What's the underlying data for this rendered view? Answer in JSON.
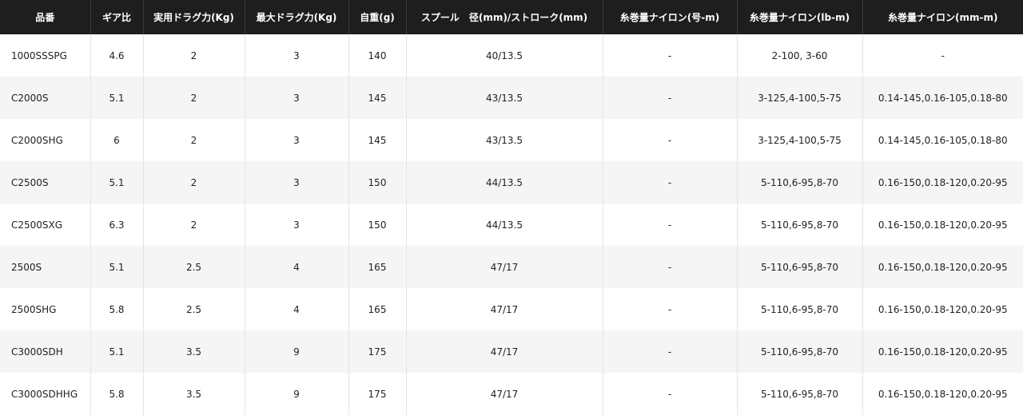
{
  "table": {
    "headers": [
      "品番",
      "ギア比",
      "実用ドラグ力(Kg)",
      "最大ドラグ力(Kg)",
      "自重(g)",
      "スプール　径(mm)/ストローク(mm)",
      "糸巻量ナイロン(号-m)",
      "糸巻量ナイロン(lb-m)",
      "糸巻量ナイロン(mm-m)"
    ],
    "rows": [
      [
        "1000SSSPG",
        "4.6",
        "2",
        "3",
        "140",
        "40/13.5",
        "-",
        "2-100, 3-60",
        "-"
      ],
      [
        "C2000S",
        "5.1",
        "2",
        "3",
        "145",
        "43/13.5",
        "-",
        "3-125,4-100,5-75",
        "0.14-145,0.16-105,0.18-80"
      ],
      [
        "C2000SHG",
        "6",
        "2",
        "3",
        "145",
        "43/13.5",
        "-",
        "3-125,4-100,5-75",
        "0.14-145,0.16-105,0.18-80"
      ],
      [
        "C2500S",
        "5.1",
        "2",
        "3",
        "150",
        "44/13.5",
        "-",
        "5-110,6-95,8-70",
        "0.16-150,0.18-120,0.20-95"
      ],
      [
        "C2500SXG",
        "6.3",
        "2",
        "3",
        "150",
        "44/13.5",
        "-",
        "5-110,6-95,8-70",
        "0.16-150,0.18-120,0.20-95"
      ],
      [
        "2500S",
        "5.1",
        "2.5",
        "4",
        "165",
        "47/17",
        "-",
        "5-110,6-95,8-70",
        "0.16-150,0.18-120,0.20-95"
      ],
      [
        "2500SHG",
        "5.8",
        "2.5",
        "4",
        "165",
        "47/17",
        "-",
        "5-110,6-95,8-70",
        "0.16-150,0.18-120,0.20-95"
      ],
      [
        "C3000SDH",
        "5.1",
        "3.5",
        "9",
        "175",
        "47/17",
        "-",
        "5-110,6-95,8-70",
        "0.16-150,0.18-120,0.20-95"
      ],
      [
        "C3000SDHHG",
        "5.8",
        "3.5",
        "9",
        "175",
        "47/17",
        "-",
        "5-110,6-95,8-70",
        "0.16-150,0.18-120,0.20-95"
      ]
    ]
  },
  "colors": {
    "header_bg": "#1e1e1e",
    "header_text": "#ffffff",
    "row_alt_bg": "#f5f5f5",
    "text": "#222222"
  }
}
